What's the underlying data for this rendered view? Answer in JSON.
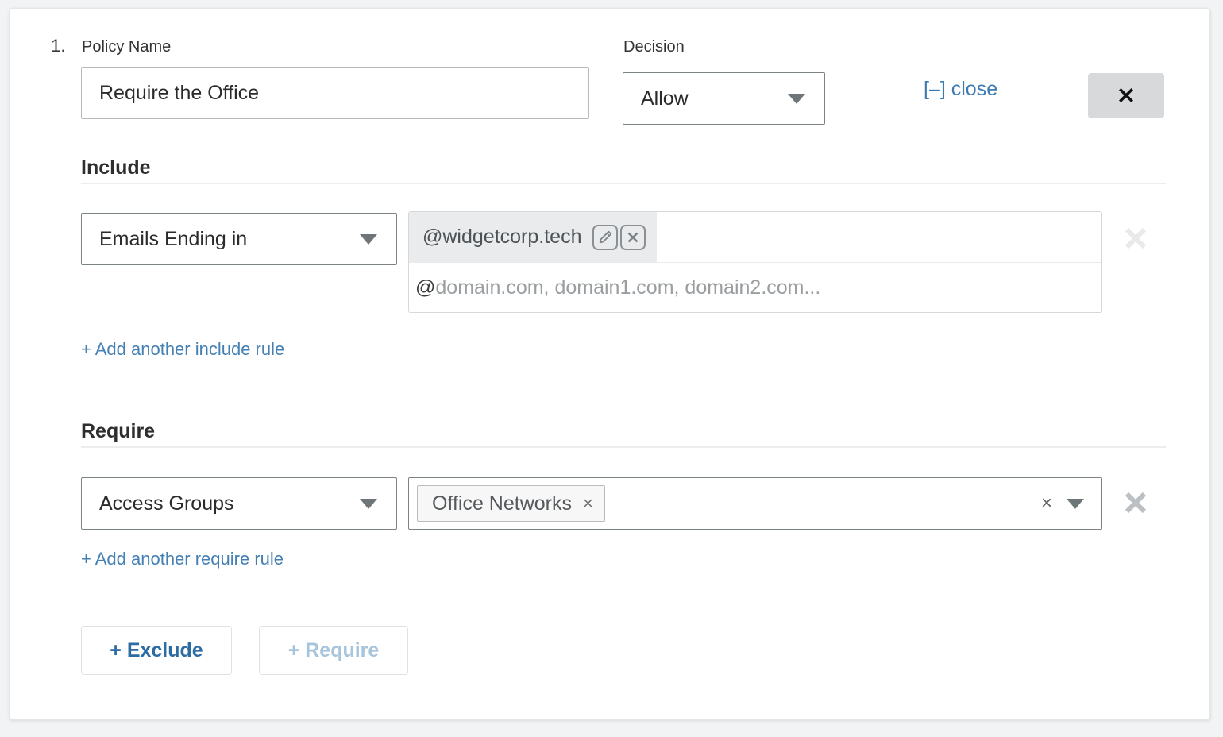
{
  "policy": {
    "index": "1.",
    "name_label": "Policy Name",
    "name_value": "Require the Office",
    "decision_label": "Decision",
    "decision_value": "Allow",
    "close_link": "[–] close",
    "close_button_icon": "close-x-icon"
  },
  "include": {
    "section_title": "Include",
    "rule_type": "Emails Ending in",
    "chip_label": "@widgetcorp.tech",
    "chip_edit_icon": "pencil-edit-icon",
    "chip_delete_icon": "x-delete-icon",
    "input_prefix": "@",
    "input_placeholder": "domain.com, domain1.com, domain2.com...",
    "input_value": "",
    "remove_row_icon": "x-remove-icon",
    "add_link": "+ Add another include rule"
  },
  "require": {
    "section_title": "Require",
    "rule_type": "Access Groups",
    "chip_label": "Office Networks",
    "chip_remove_icon": "x-small-icon",
    "clear_icon": "clear-x-icon",
    "dropdown_icon": "caret-down-icon",
    "remove_row_icon": "x-remove-icon",
    "add_link": "+ Add another require rule"
  },
  "footer": {
    "exclude_button": "+ Exclude",
    "require_button": "+ Require"
  },
  "colors": {
    "link_blue": "#3d7bb2",
    "disabled_blue": "#a7c4dd",
    "chip_gray": "#e9ebec",
    "border_gray": "#7c8386",
    "card_white": "#ffffff",
    "page_bg": "#f2f3f4"
  }
}
